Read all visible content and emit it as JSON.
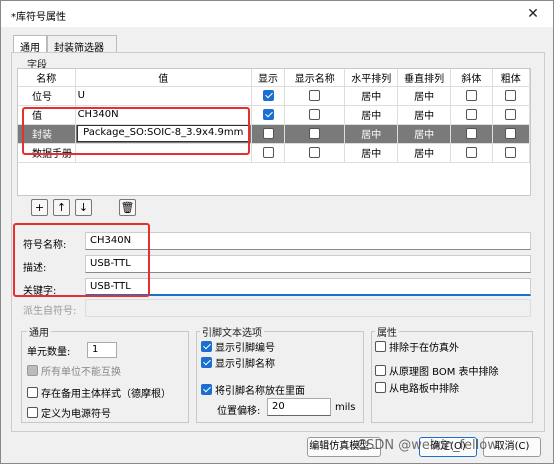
{
  "window": {
    "title": "*库符号属性",
    "close_icon": "close-icon"
  },
  "tabs": [
    "通用",
    "封装筛选器"
  ],
  "fields_group": "字段",
  "table": {
    "headers": [
      "名称",
      "值",
      "显示",
      "显示名称",
      "水平排列",
      "垂直排列",
      "斜体",
      "粗体"
    ],
    "rows": [
      {
        "name": "位号",
        "value": "U",
        "show": true,
        "showname": false,
        "h": "居中",
        "v": "居中",
        "italic": false,
        "bold": false
      },
      {
        "name": "值",
        "value": "CH340N",
        "show": true,
        "showname": false,
        "h": "居中",
        "v": "居中",
        "italic": false,
        "bold": false
      },
      {
        "name": "封装",
        "value": "Package_SO:SOIC-8_3.9x4.9mm",
        "show": false,
        "showname": false,
        "h": "居中",
        "v": "居中",
        "italic": false,
        "bold": false
      },
      {
        "name": "数据手册",
        "value": "",
        "show": false,
        "showname": false,
        "h": "居中",
        "v": "居中",
        "italic": false,
        "bold": false
      }
    ]
  },
  "toolbar": {
    "add_icon": "add-icon",
    "up_icon": "arrow-up-icon",
    "down_icon": "arrow-down-icon",
    "delete_icon": "trash-icon"
  },
  "symbol": {
    "name_label": "符号名称:",
    "name_value": "CH340N",
    "desc_label": "描述:",
    "desc_value": "USB-TTL",
    "kw_label": "关键字:",
    "kw_value": "USB-TTL",
    "derived_label": "派生自符号:"
  },
  "general": {
    "title": "通用",
    "units_label": "单元数量:",
    "units_value": "1",
    "interchange": "所有单位不能互换",
    "demorgan": "存在备用主体样式（德摩根）",
    "power": "定义为电源符号"
  },
  "pin_text": {
    "title": "引脚文本选项",
    "show_number": "显示引脚编号",
    "show_name": "显示引脚名称",
    "inside": "将引脚名称放在里面",
    "offset_label": "位置偏移:",
    "offset_value": "20",
    "unit": "mils"
  },
  "attributes": {
    "title": "属性",
    "exclude_sim": "排除于在仿真外",
    "exclude_bom": "从原理图 BOM 表中排除",
    "exclude_board": "从电路板中排除"
  },
  "buttons": {
    "sim_model": "编辑仿真模型...",
    "ok": "确定(O)",
    "cancel": "取消(C)"
  },
  "watermark": "CSDN @weixin_fellow",
  "colors": {
    "accent": "#1a6fd0",
    "highlight": "#e53030"
  }
}
